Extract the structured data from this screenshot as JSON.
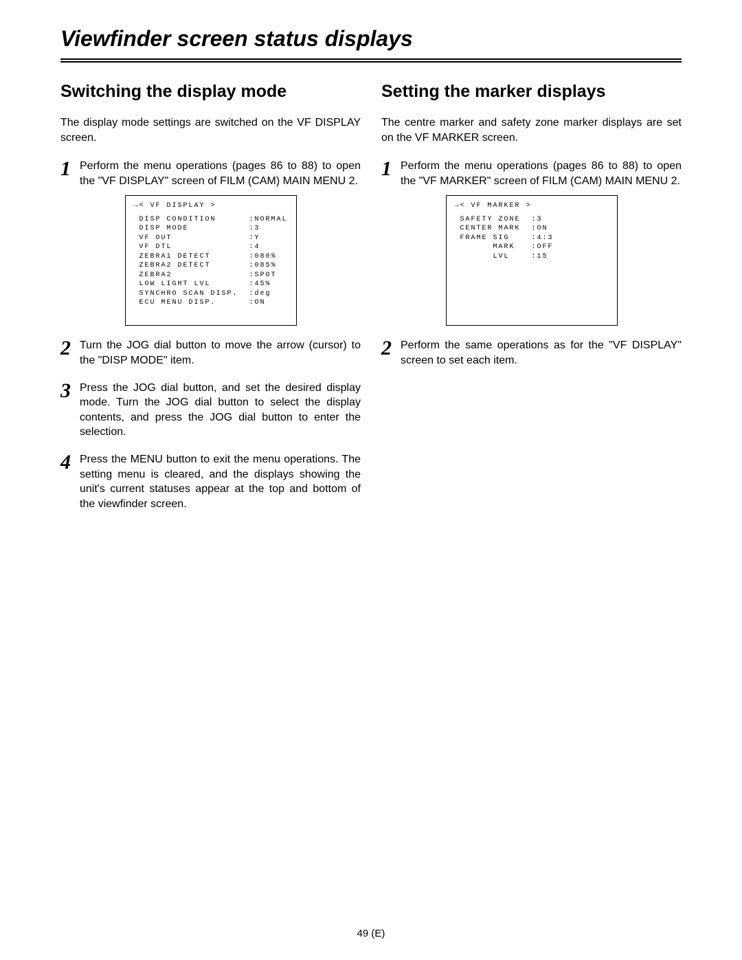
{
  "title": "Viewfinder screen status displays",
  "footer": "49 (E)",
  "left": {
    "heading": "Switching the display mode",
    "intro": "The display mode settings are switched on the VF DISPLAY screen.",
    "steps": {
      "s1": "Perform the menu operations (pages 86 to 88) to open the \"VF DISPLAY\" screen of FILM (CAM) MAIN MENU 2.",
      "s2": "Turn the JOG dial button to move the arrow (cursor) to the \"DISP MODE\" item.",
      "s3": "Press the JOG dial button, and set the desired display mode.\nTurn the JOG dial button to select the display contents, and press the JOG dial button to enter the selection.",
      "s4": "Press the MENU button to exit the menu operations.\nThe setting menu is cleared, and the displays showing the unit's current statuses appear at the top and bottom of the viewfinder screen."
    },
    "menu": {
      "title": "→< VF DISPLAY >",
      "rows": [
        {
          "label": "DISP CONDITION",
          "value": ":NORMAL"
        },
        {
          "label": "DISP MODE",
          "value": ":3"
        },
        {
          "label": "VF OUT",
          "value": ":Y"
        },
        {
          "label": "VF DTL",
          "value": ":4"
        },
        {
          "label": "ZEBRA1 DETECT",
          "value": ":080%"
        },
        {
          "label": "ZEBRA2 DETECT",
          "value": ":085%"
        },
        {
          "label": "ZEBRA2",
          "value": ":SPOT"
        },
        {
          "label": "LOW LIGHT LVL",
          "value": ":45%"
        },
        {
          "label": "SYNCHRO SCAN DISP.",
          "value": ":deg"
        },
        {
          "label": "ECU MENU DISP.",
          "value": ":ON"
        }
      ]
    }
  },
  "right": {
    "heading": "Setting the marker displays",
    "intro": "The centre marker and safety zone marker displays are set on the VF MARKER screen.",
    "steps": {
      "s1": "Perform the menu operations (pages 86 to 88) to open the \"VF MARKER\" screen of FILM (CAM) MAIN MENU 2.",
      "s2": "Perform the same operations as for the \"VF DISPLAY\" screen to set each item."
    },
    "menu": {
      "title": "→< VF MARKER >",
      "rows": [
        {
          "label": "SAFETY ZONE",
          "value": ":3"
        },
        {
          "label": "CENTER MARK",
          "value": ":ON"
        },
        {
          "label": "FRAME SIG",
          "value": ":4:3"
        },
        {
          "label": "      MARK",
          "value": ":OFF"
        },
        {
          "label": "      LVL",
          "value": ":15"
        }
      ]
    }
  }
}
